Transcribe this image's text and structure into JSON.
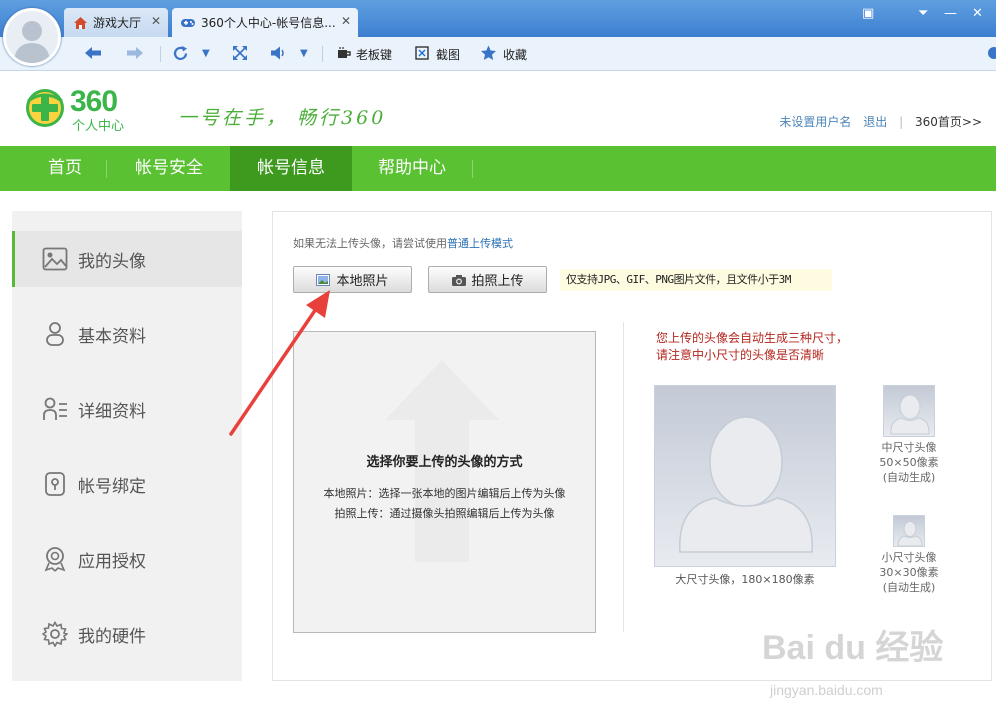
{
  "browser": {
    "tabs": [
      {
        "label": "游戏大厅",
        "icon": "home-icon"
      },
      {
        "label": "360个人中心-帐号信息...",
        "icon": "gamepad-icon"
      }
    ],
    "toolbar": {
      "boss_key": "老板键",
      "screenshot": "截图",
      "favorites": "收藏"
    }
  },
  "header": {
    "logo_text": "360",
    "logo_sub": "个人中心",
    "slogan": "一号在手， 畅行360",
    "username": "未设置用户名",
    "logout": "退出",
    "separator": "|",
    "home_link": "360首页>>"
  },
  "nav": {
    "items": [
      {
        "label": "首页"
      },
      {
        "label": "帐号安全"
      },
      {
        "label": "帐号信息"
      },
      {
        "label": "帮助中心"
      }
    ],
    "active_index": 2
  },
  "sidebar": {
    "items": [
      {
        "label": "我的头像",
        "icon": "image-icon"
      },
      {
        "label": "基本资料",
        "icon": "user-icon"
      },
      {
        "label": "详细资料",
        "icon": "user-detail-icon"
      },
      {
        "label": "帐号绑定",
        "icon": "lock-icon"
      },
      {
        "label": "应用授权",
        "icon": "badge-icon"
      },
      {
        "label": "我的硬件",
        "icon": "gear-icon"
      }
    ],
    "active_index": 0
  },
  "main": {
    "hint_prefix": "如果无法上传头像，请尝试使用",
    "hint_link": "普通上传模式",
    "local_button": "本地照片",
    "camera_button": "拍照上传",
    "format_tip": "仅支持JPG、GIF、PNG图片文件，且文件小于3M",
    "upload_title": "选择你要上传的头像的方式",
    "upload_line1": "本地照片：选择一张本地的图片编辑后上传为头像",
    "upload_line2": "拍照上传：通过摄像头拍照编辑后上传为头像",
    "note_line1": "您上传的头像会自动生成三种尺寸，",
    "note_line2": "请注意中小尺寸的头像是否清晰",
    "large_caption": "大尺寸头像，180×180像素",
    "medium_caption": [
      "中尺寸头像",
      "50×50像素",
      "(自动生成)"
    ],
    "small_caption": [
      "小尺寸头像",
      "30×30像素",
      "(自动生成)"
    ]
  },
  "watermark": {
    "text": "Bai du 经验",
    "url": "jingyan.baidu.com"
  },
  "colors": {
    "nav_green": "#5ac133",
    "nav_active": "#3e9a1f",
    "accent_red": "#e8413b"
  }
}
